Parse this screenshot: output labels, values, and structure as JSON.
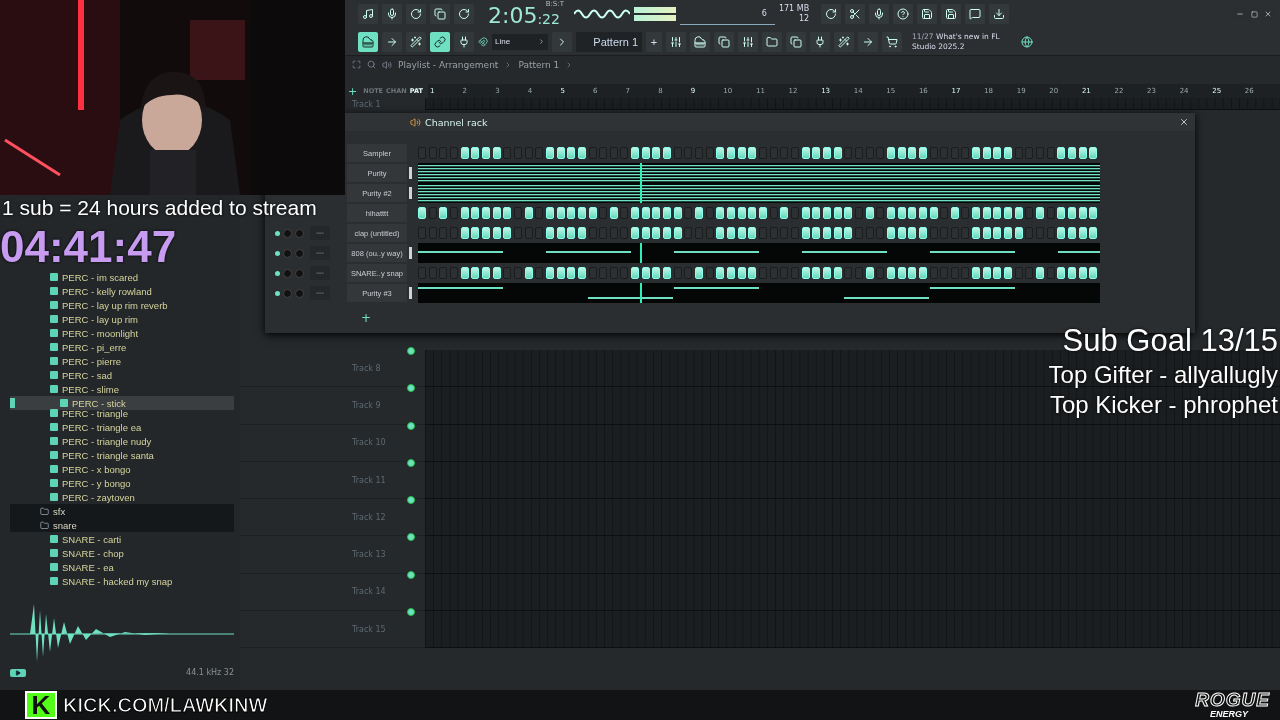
{
  "stream_overlay": {
    "sub_rule": "1 sub = 24 hours added to stream",
    "timer": "04:41:47",
    "sub_goal": "Sub Goal 13/15",
    "top_gifter": "Top Gifter - allyallugly",
    "top_kicker": "Top Kicker - phrophet"
  },
  "toolbar": {
    "time": "2:05",
    "time_small": ":22",
    "time_label": "B:S:T",
    "cpu": "6",
    "memory": "171 MB",
    "polyphony": "12",
    "snap": "Line",
    "pattern": "Pattern 1",
    "add": "+",
    "news_count": "11/27",
    "news": "What's new in FL Studio 2025.2"
  },
  "playlist": {
    "breadcrumb": [
      "Playlist - Arrangement",
      "Pattern 1"
    ],
    "modes": [
      {
        "label": "NOTE",
        "selected": false
      },
      {
        "label": "CHAN",
        "selected": false
      },
      {
        "label": "PAT",
        "selected": true
      }
    ],
    "add": "+",
    "ruler": [
      "1",
      "2",
      "3",
      "4",
      "5",
      "6",
      "7",
      "8",
      "9",
      "10",
      "11",
      "12",
      "13",
      "14",
      "15",
      "16",
      "17",
      "18",
      "19",
      "20",
      "21",
      "22",
      "23",
      "24",
      "25",
      "26"
    ],
    "tracks_top": [
      "Track 1"
    ],
    "tracks": [
      "Track 8",
      "Track 9",
      "Track 10",
      "Track 11",
      "Track 12",
      "Track 13",
      "Track 14",
      "Track 15"
    ]
  },
  "channel_rack": {
    "title": "Channel rack",
    "add": "+",
    "channels": [
      {
        "name": "Sampler",
        "kind": "steps",
        "steps": [
          false,
          false,
          false,
          false,
          true,
          true,
          true,
          true,
          false,
          false,
          false,
          false,
          true,
          true,
          true,
          true,
          false,
          false,
          false,
          false,
          true,
          true,
          true,
          true,
          false,
          false,
          false,
          false,
          true,
          true,
          true,
          true,
          false,
          false,
          false,
          false,
          true,
          true,
          true,
          true,
          false,
          false,
          false,
          false,
          true,
          true,
          true,
          true,
          false,
          false,
          false,
          false,
          true,
          true,
          true,
          true,
          false,
          false,
          false,
          false,
          true,
          true,
          true,
          true
        ]
      },
      {
        "name": "Purity",
        "kind": "notes"
      },
      {
        "name": "Purity #2",
        "kind": "notes"
      },
      {
        "name": "hihatttt",
        "kind": "steps",
        "steps": [
          true,
          false,
          true,
          false,
          true,
          true,
          true,
          true,
          true,
          false,
          true,
          false,
          true,
          true,
          true,
          true,
          true,
          false,
          true,
          false,
          true,
          true,
          true,
          true,
          true,
          false,
          true,
          false,
          true,
          true,
          true,
          true,
          true,
          false,
          true,
          false,
          true,
          true,
          true,
          true,
          true,
          false,
          true,
          false,
          true,
          true,
          true,
          true,
          true,
          false,
          true,
          false,
          true,
          true,
          true,
          true,
          true,
          false,
          true,
          false,
          true,
          true,
          true,
          true
        ]
      },
      {
        "name": "clap (untitled)",
        "kind": "steps",
        "mixer": "---",
        "steps": [
          false,
          false,
          false,
          false,
          true,
          true,
          true,
          true,
          true,
          false,
          false,
          false,
          true,
          true,
          true,
          true,
          false,
          false,
          false,
          false,
          true,
          true,
          true,
          true,
          true,
          false,
          false,
          false,
          true,
          true,
          true,
          true,
          false,
          false,
          false,
          false,
          true,
          true,
          true,
          true,
          true,
          false,
          false,
          false,
          true,
          true,
          true,
          true,
          false,
          false,
          false,
          false,
          true,
          true,
          true,
          true,
          true,
          false,
          false,
          false,
          true,
          true,
          true,
          true
        ]
      },
      {
        "name": "808 (ou..y way)",
        "kind": "notes",
        "mixer": "---"
      },
      {
        "name": "SNARE..y snap",
        "kind": "steps",
        "mixer": "---",
        "steps": [
          false,
          false,
          false,
          false,
          true,
          true,
          true,
          true,
          false,
          false,
          true,
          false,
          true,
          true,
          true,
          true,
          false,
          false,
          false,
          false,
          true,
          true,
          true,
          true,
          false,
          false,
          true,
          false,
          true,
          true,
          true,
          true,
          false,
          false,
          false,
          false,
          true,
          true,
          true,
          true,
          false,
          false,
          true,
          false,
          true,
          true,
          true,
          true,
          false,
          false,
          false,
          false,
          true,
          true,
          true,
          true,
          false,
          false,
          true,
          false,
          true,
          true,
          true,
          true
        ]
      },
      {
        "name": "Purity #3",
        "kind": "notes",
        "mixer": "---"
      }
    ]
  },
  "browser": {
    "items": [
      {
        "kind": "file",
        "label": "PERC - im scared",
        "selected": false
      },
      {
        "kind": "file",
        "label": "PERC - kelly rowland",
        "selected": false
      },
      {
        "kind": "file",
        "label": "PERC - lay up rim reverb",
        "selected": false
      },
      {
        "kind": "file",
        "label": "PERC - lay up rim",
        "selected": false
      },
      {
        "kind": "file",
        "label": "PERC - moonlight",
        "selected": false
      },
      {
        "kind": "file",
        "label": "PERC - pi_erre",
        "selected": false
      },
      {
        "kind": "file",
        "label": "PERC - pierre",
        "selected": false
      },
      {
        "kind": "file",
        "label": "PERC - sad",
        "selected": false
      },
      {
        "kind": "file",
        "label": "PERC - slime",
        "selected": false
      },
      {
        "kind": "file",
        "label": "PERC - stick",
        "selected": true
      },
      {
        "kind": "file",
        "label": "PERC - triangle",
        "selected": false
      },
      {
        "kind": "file",
        "label": "PERC - triangle ea",
        "selected": false
      },
      {
        "kind": "file",
        "label": "PERC - triangle nudy",
        "selected": false
      },
      {
        "kind": "file",
        "label": "PERC - triangle santa",
        "selected": false
      },
      {
        "kind": "file",
        "label": "PERC - x bongo",
        "selected": false
      },
      {
        "kind": "file",
        "label": "PERC - y bongo",
        "selected": false
      },
      {
        "kind": "file",
        "label": "PERC - zaytoven",
        "selected": false
      },
      {
        "kind": "folder",
        "label": "sfx",
        "selected": false
      },
      {
        "kind": "folder",
        "label": "snare",
        "selected": false,
        "children": [
          {
            "kind": "file",
            "label": "SNARE - carti",
            "selected": false
          },
          {
            "kind": "file",
            "label": "SNARE - chop",
            "selected": false
          },
          {
            "kind": "file",
            "label": "SNARE - ea",
            "selected": false
          },
          {
            "kind": "file",
            "label": "SNARE - hacked my snap",
            "selected": false
          }
        ]
      }
    ],
    "sample_rate": "44.1 kHz 32"
  },
  "footer": {
    "kick_badge": "K",
    "kick_url": "KICK.COM/LAWKINW",
    "sponsor": "ROGUE",
    "sponsor_sub": "ENERGY"
  }
}
